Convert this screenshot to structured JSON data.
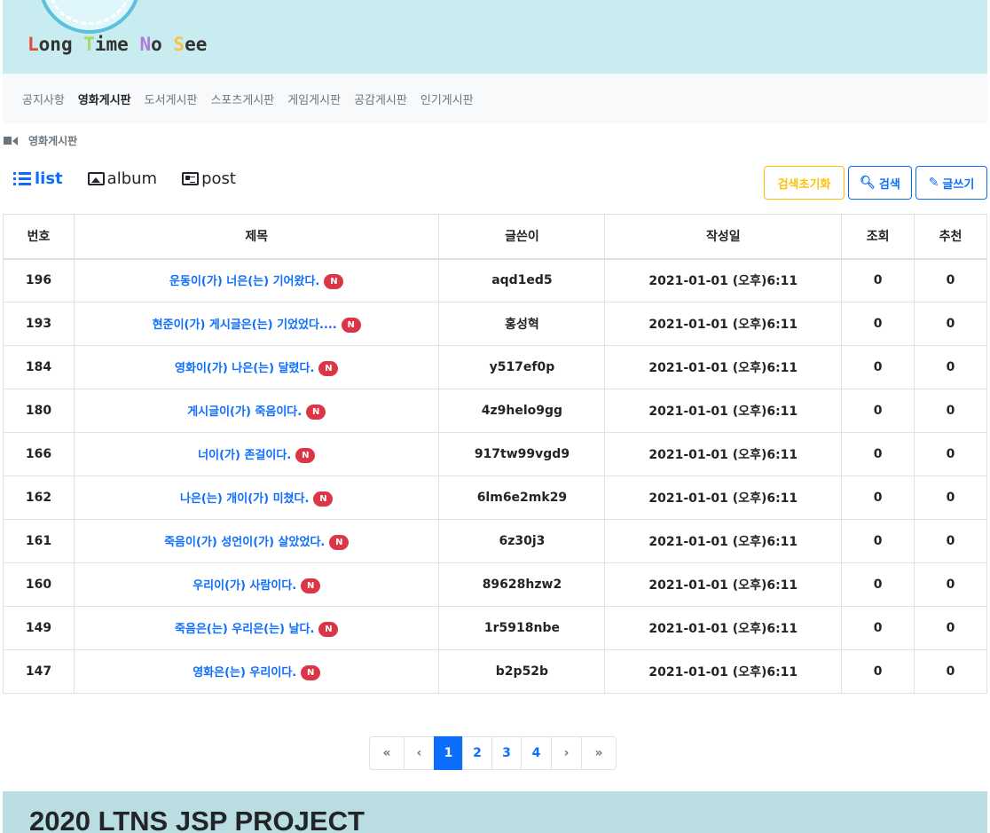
{
  "header": {
    "title_parts": [
      "L",
      "ong ",
      "T",
      "ime ",
      "N",
      "o ",
      "S",
      "ee"
    ]
  },
  "nav": {
    "items": [
      "공지사항",
      "영화게시판",
      "도서게시판",
      "스포츠게시판",
      "게임게시판",
      "공감게시판",
      "인기게시판"
    ],
    "active_index": 1
  },
  "breadcrumb": {
    "label": "영화게시판"
  },
  "view_tabs": {
    "list": "list",
    "album": "album",
    "post": "post"
  },
  "actions": {
    "reset": "검색초기화",
    "search": "검색",
    "write": "글쓰기"
  },
  "table": {
    "headers": [
      "번호",
      "제목",
      "글쓴이",
      "작성일",
      "조회",
      "추천"
    ],
    "badge": "N",
    "rows": [
      {
        "no": "196",
        "title": "운동이(가) 너은(는) 기어왔다.",
        "author": "aqd1ed5",
        "date": "2021-01-01 (오후)6:11",
        "views": "0",
        "likes": "0"
      },
      {
        "no": "193",
        "title": "현준이(가) 게시글은(는) 기었었다....",
        "author": "홍성혁",
        "date": "2021-01-01 (오후)6:11",
        "views": "0",
        "likes": "0"
      },
      {
        "no": "184",
        "title": "영화이(가) 나은(는) 달렸다.",
        "author": "y517ef0p",
        "date": "2021-01-01 (오후)6:11",
        "views": "0",
        "likes": "0"
      },
      {
        "no": "180",
        "title": "게시글이(가) 죽음이다.",
        "author": "4z9helo9gg",
        "date": "2021-01-01 (오후)6:11",
        "views": "0",
        "likes": "0"
      },
      {
        "no": "166",
        "title": "너이(가) 존걸이다.",
        "author": "917tw99vgd9",
        "date": "2021-01-01 (오후)6:11",
        "views": "0",
        "likes": "0"
      },
      {
        "no": "162",
        "title": "나은(는) 개이(가) 미쳤다.",
        "author": "6lm6e2mk29",
        "date": "2021-01-01 (오후)6:11",
        "views": "0",
        "likes": "0"
      },
      {
        "no": "161",
        "title": "죽음이(가) 성언이(가) 살았었다.",
        "author": "6z30j3",
        "date": "2021-01-01 (오후)6:11",
        "views": "0",
        "likes": "0"
      },
      {
        "no": "160",
        "title": "우리이(가) 사람이다.",
        "author": "89628hzw2",
        "date": "2021-01-01 (오후)6:11",
        "views": "0",
        "likes": "0"
      },
      {
        "no": "149",
        "title": "죽음은(는) 우리은(는) 날다.",
        "author": "1r5918nbe",
        "date": "2021-01-01 (오후)6:11",
        "views": "0",
        "likes": "0"
      },
      {
        "no": "147",
        "title": "영화은(는) 우리이다.",
        "author": "b2p52b",
        "date": "2021-01-01 (오후)6:11",
        "views": "0",
        "likes": "0"
      }
    ]
  },
  "pagination": {
    "first": "«",
    "prev": "‹",
    "next": "›",
    "last": "»",
    "pages": [
      "1",
      "2",
      "3",
      "4"
    ],
    "current": "1"
  },
  "footer": {
    "title": "2020 LTNS JSP PROJECT"
  },
  "colors": {
    "header_bg": "#c8ecef",
    "footer_bg": "#b9dde0",
    "primary": "#0d6efd",
    "warning": "#ffc107",
    "badge": "#dc3545"
  },
  "icons": {
    "breadcrumb": "video-camera-icon",
    "search": "magnifier-icon",
    "write": "pencil-icon"
  }
}
